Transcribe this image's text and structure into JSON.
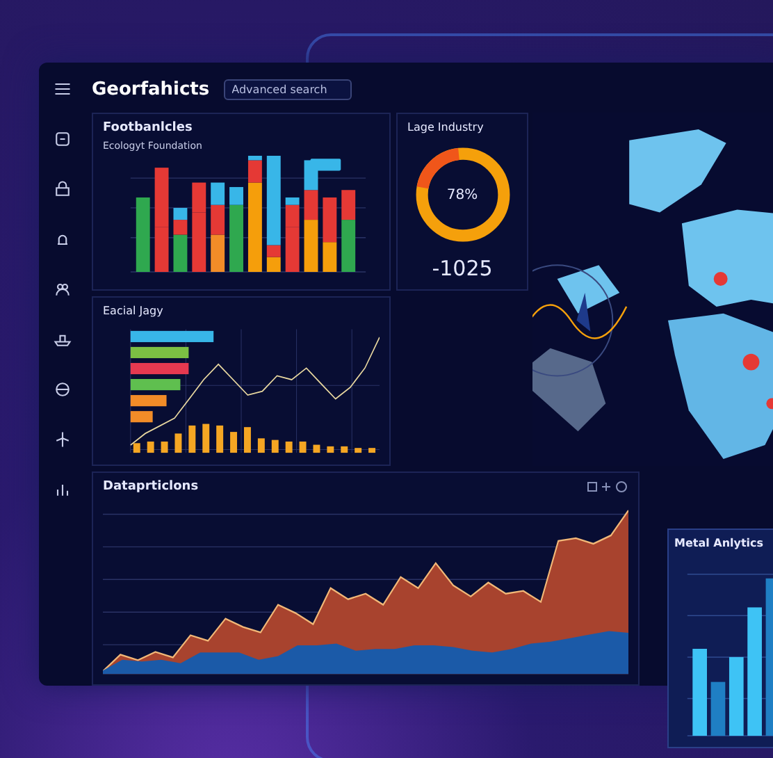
{
  "header": {
    "title": "Georfahicts",
    "search": {
      "placeholder": "Advanced search"
    }
  },
  "panels": {
    "bar_panel": {
      "title": "Footbanlcles",
      "subtitle": "Ecologyt Foundation"
    },
    "donut_panel": {
      "title": "Lage Industry",
      "percent": "78%",
      "value": "-1025"
    },
    "trend_panel": {
      "title": "Eacial Jagy"
    },
    "area_panel": {
      "title": "Dataprticlons"
    },
    "metal_panel": {
      "title": "Metal Anlytics"
    }
  }
}
